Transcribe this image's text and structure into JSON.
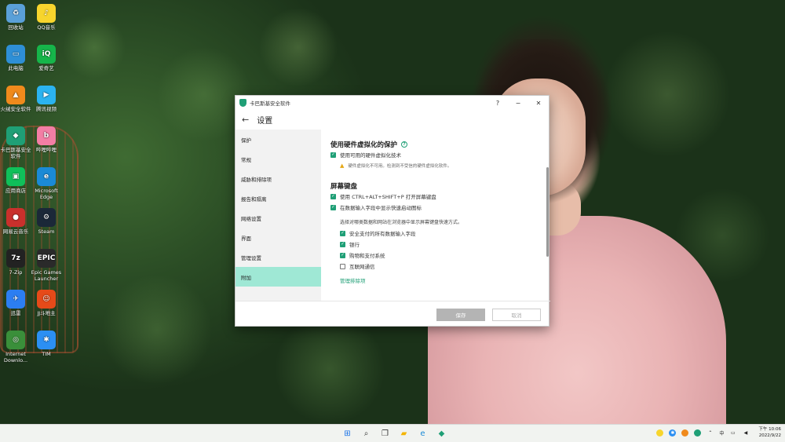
{
  "desktop_icons": [
    {
      "label": "回收站",
      "icon": "recycle-bin-icon",
      "color": "#5aa0d8",
      "glyph": "♻"
    },
    {
      "label": "QQ音乐",
      "icon": "qq-music-icon",
      "color": "#f7d52d",
      "glyph": "♪"
    },
    {
      "label": "此电脑",
      "icon": "computer-icon",
      "color": "#2e8fd6",
      "glyph": "▭"
    },
    {
      "label": "爱奇艺",
      "icon": "iqiyi-icon",
      "color": "#16b54a",
      "glyph": "iQ"
    },
    {
      "label": "火绒安全软件",
      "icon": "huorong-icon",
      "color": "#f08a1c",
      "glyph": "▲"
    },
    {
      "label": "腾讯视频",
      "icon": "tencent-video-icon",
      "color": "#2bb3f0",
      "glyph": "▶"
    },
    {
      "label": "卡巴斯基安全软件",
      "icon": "kaspersky-icon",
      "color": "#1f9f76",
      "glyph": "◆"
    },
    {
      "label": "哔哩哔哩",
      "icon": "bilibili-icon",
      "color": "#f37ea5",
      "glyph": "b"
    },
    {
      "label": "应用商店",
      "icon": "app-store-icon",
      "color": "#10c05a",
      "glyph": "▣"
    },
    {
      "label": "Microsoft Edge",
      "icon": "edge-icon",
      "color": "#1b8ad6",
      "glyph": "e"
    },
    {
      "label": "网易云音乐",
      "icon": "netease-music-icon",
      "color": "#c9302c",
      "glyph": "●"
    },
    {
      "label": "Steam",
      "icon": "steam-icon",
      "color": "#1b2838",
      "glyph": "⚙"
    },
    {
      "label": "7-Zip",
      "icon": "7zip-icon",
      "color": "#222222",
      "glyph": "7z"
    },
    {
      "label": "Epic Games Launcher",
      "icon": "epic-games-icon",
      "color": "#2a2a2a",
      "glyph": "EPIC"
    },
    {
      "label": "迅雷",
      "icon": "xunlei-icon",
      "color": "#2c7ef2",
      "glyph": "✈"
    },
    {
      "label": "JJ斗地主",
      "icon": "jj-game-icon",
      "color": "#e64a19",
      "glyph": "☺"
    },
    {
      "label": "Internet Downlo...",
      "icon": "idm-icon",
      "color": "#3a8f3a",
      "glyph": "◎"
    },
    {
      "label": "TIM",
      "icon": "tim-icon",
      "color": "#2c8ff2",
      "glyph": "✱"
    }
  ],
  "window": {
    "title": "卡巴斯基安全软件",
    "help_glyph": "?",
    "minimize_glyph": "−",
    "close_glyph": "✕",
    "back_glyph": "←",
    "page_title": "设置"
  },
  "sidebar": {
    "items": [
      {
        "label": "保护",
        "active": false
      },
      {
        "label": "常规",
        "active": false
      },
      {
        "label": "威胁和排除项",
        "active": false
      },
      {
        "label": "报告和隔离",
        "active": false
      },
      {
        "label": "网络设置",
        "active": false
      },
      {
        "label": "界面",
        "active": false
      },
      {
        "label": "管理设置",
        "active": false
      },
      {
        "label": "附加",
        "active": true
      }
    ]
  },
  "content": {
    "section1_title": "使用硬件虚拟化的保护",
    "help_glyph": "?",
    "hw_virt_label": "使用可用的硬件虚拟化技术",
    "hw_virt_checked": true,
    "warning_text": "硬件虚拟化不可用。检测到不受信的硬件虚拟化软件。",
    "section2_title": "屏幕键盘",
    "kb_shortcut_label": "使用 CTRL+ALT+SHIFT+P 打开屏幕键盘",
    "kb_shortcut_checked": true,
    "kb_icon_label": "在数据输入字段中显示快速启动图标",
    "kb_icon_checked": true,
    "note_text": "选择对哪类数据和网站在浏览器中显示屏幕键盘快速方式。",
    "sub_options": [
      {
        "label": "安全支付的所有数据输入字段",
        "checked": true
      },
      {
        "label": "银行",
        "checked": true
      },
      {
        "label": "购物和支付系统",
        "checked": true
      },
      {
        "label": "互联网通信",
        "checked": false
      }
    ],
    "link_text": "管理排除项"
  },
  "footer": {
    "save_label": "保存",
    "cancel_label": "取消"
  },
  "taskbar": {
    "apps": [
      {
        "name": "start-icon",
        "glyph": "⊞",
        "color": "#1a73e8"
      },
      {
        "name": "search-icon",
        "glyph": "⌕",
        "color": "#333333"
      },
      {
        "name": "task-view-icon",
        "glyph": "❐",
        "color": "#333333"
      },
      {
        "name": "file-explorer-icon",
        "glyph": "▰",
        "color": "#f4b400"
      },
      {
        "name": "edge-icon",
        "glyph": "e",
        "color": "#1b8ad6"
      },
      {
        "name": "kaspersky-icon",
        "glyph": "◆",
        "color": "#1f9f76"
      }
    ],
    "tray_ime": "中",
    "time": "下午 10:06",
    "date": "2022/9/22"
  },
  "colors": {
    "accent": "#1f9f76",
    "active_nav": "#9fe8d5"
  }
}
